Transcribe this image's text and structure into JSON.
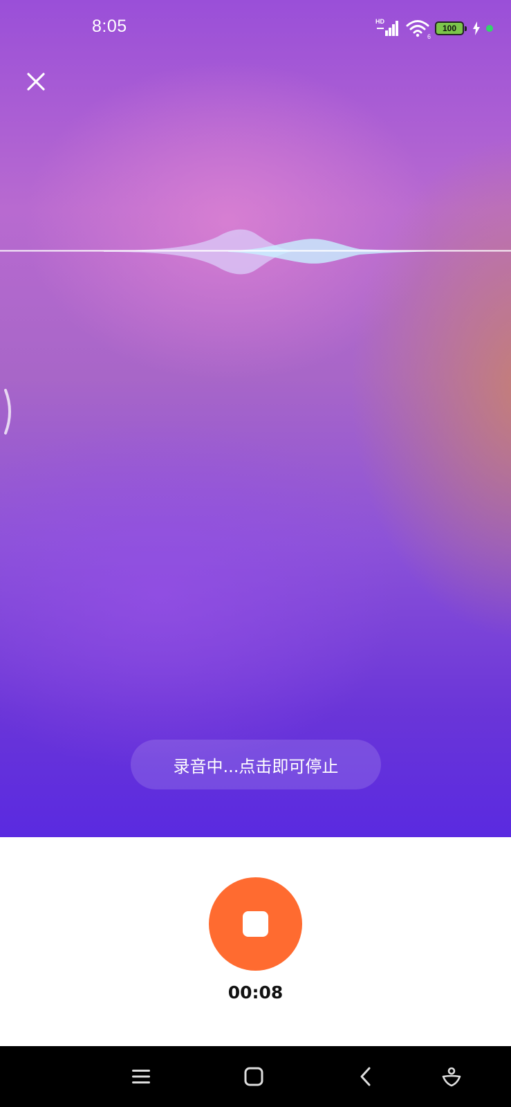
{
  "status_bar": {
    "time": "8:05",
    "network_label": "HD",
    "wifi_label": "6",
    "battery_level": "100",
    "icons": [
      "hd-signal-icon",
      "wifi-icon",
      "battery-icon",
      "charging-bolt-icon",
      "green-dot-indicator"
    ]
  },
  "close_icon": "close-icon",
  "hint": {
    "text": "录音中...点击即可停止"
  },
  "recorder": {
    "stop_icon": "stop-icon",
    "elapsed": "00:08"
  },
  "nav_bar": {
    "icons": [
      "menu-icon",
      "home-icon",
      "back-icon",
      "assistant-icon"
    ]
  },
  "colors": {
    "accent_orange": "#ff6b30",
    "gradient_top": "#9a4fd8",
    "gradient_bottom": "#5a2ae0"
  }
}
